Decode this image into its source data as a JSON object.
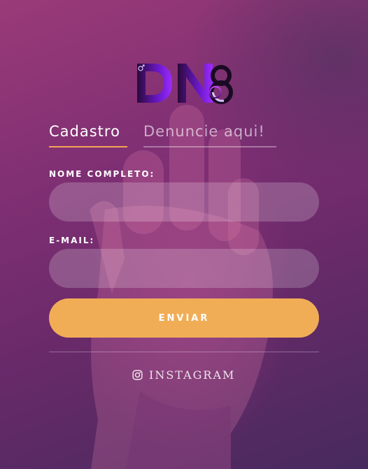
{
  "brand": {
    "logo_text": "DN"
  },
  "tabs": [
    {
      "label": "Cadastro",
      "active": true
    },
    {
      "label": "Denuncie aqui!",
      "active": false
    }
  ],
  "form": {
    "name_label": "NOME COMPLETO:",
    "name_value": "",
    "email_label": "E-MAIL:",
    "email_value": "",
    "submit_label": "ENVIAR"
  },
  "social": {
    "label": "INSTAGRAM",
    "icon": "instagram-icon"
  },
  "colors": {
    "accent": "#f1ad56",
    "bg_top": "#9a3a78",
    "bg_bottom": "#472a5e"
  }
}
